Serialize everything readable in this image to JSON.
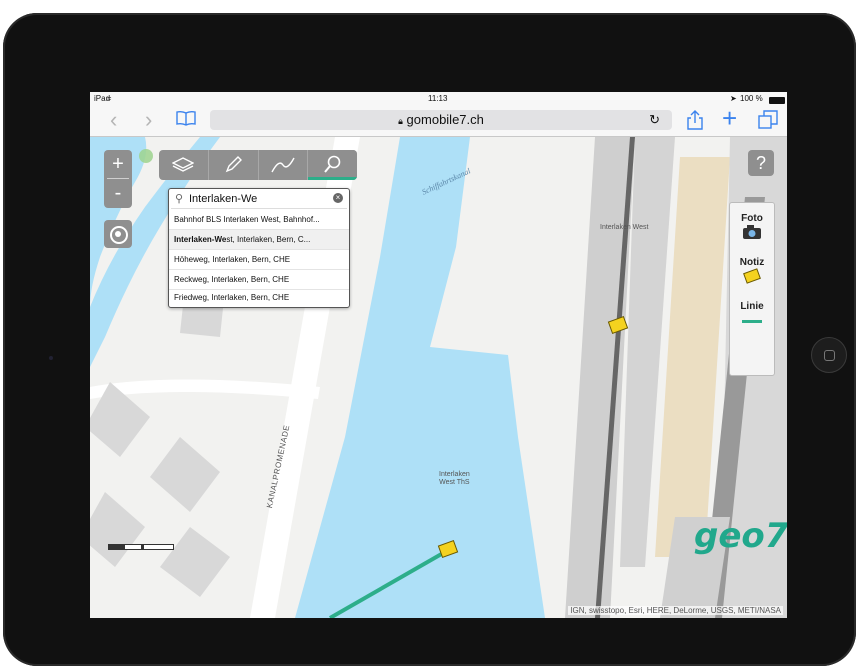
{
  "status_bar": {
    "device": "iPad",
    "time": "11:13",
    "battery": "100 %"
  },
  "browser": {
    "url": "gomobile7.ch",
    "back_icon": "chevron-left-icon",
    "forward_icon": "chevron-right-icon",
    "bookmarks_icon": "book-icon",
    "lock_icon": "lock-icon",
    "reload_icon": "reload-icon",
    "share_icon": "share-icon",
    "new_tab_icon": "plus-icon",
    "tabs_icon": "tabs-icon"
  },
  "map_controls": {
    "zoom_in": "+",
    "zoom_out": "-",
    "help": "?"
  },
  "search": {
    "query": "Interlaken-We",
    "suggestions": [
      {
        "bold": "",
        "text": "Bahnhof BLS Interlaken West, Bahnhof..."
      },
      {
        "bold": "Interlaken-We",
        "text": "st, Interlaken, Bern, C..."
      },
      {
        "bold": "",
        "text": "Höheweg, Interlaken, Bern, CHE"
      },
      {
        "bold": "",
        "text": "Reckweg, Interlaken, Bern, CHE"
      },
      {
        "bold": "",
        "text": "Friedweg, Interlaken, Bern, CHE"
      }
    ]
  },
  "side_panel": {
    "foto_label": "Foto",
    "notiz_label": "Notiz",
    "linie_label": "Linie"
  },
  "map_labels": {
    "canal": "Schiffahrtskanal",
    "station": "Interlaken West",
    "street": "KANALPROMENADE",
    "stop_line1": "Interlaken",
    "stop_line2": "West ThS"
  },
  "brand": "geo7",
  "attribution": "IGN, swisstopo, Esri, HERE, DeLorme, USGS, METI/NASA",
  "colors": {
    "accent": "#2dae8a",
    "water": "#aee0f7",
    "rail": "#e8dcc2"
  }
}
